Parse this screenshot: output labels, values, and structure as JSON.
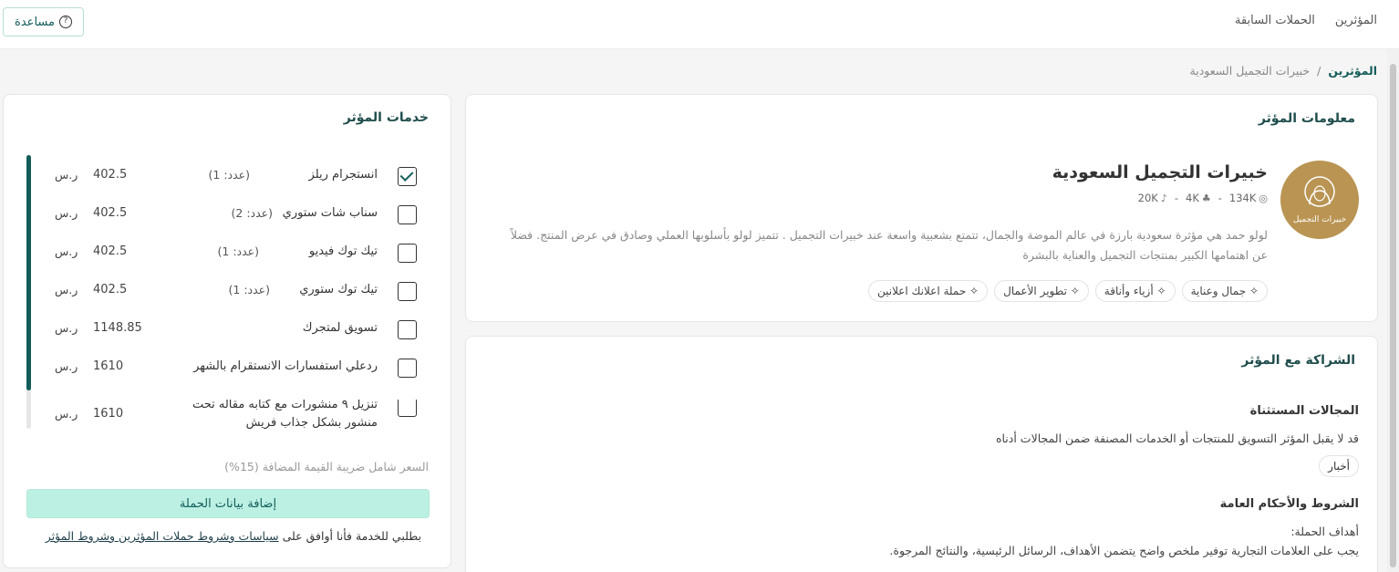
{
  "nav": {
    "influencers": "المؤثرين",
    "past_campaigns": "الحملات السابقة",
    "help": "مساعدة"
  },
  "breadcrumb": {
    "home": "المؤثرين",
    "sep": "/",
    "current": "خبيرات التجميل السعودية"
  },
  "info": {
    "title": "معلومات المؤثر",
    "name": "خبيرات التجميل السعودية",
    "avatar_text": "خبيرات التجميل",
    "stats": [
      {
        "icon": "instagram-icon",
        "glyph": "◎",
        "value": "134K"
      },
      {
        "icon": "snapchat-icon",
        "glyph": "♣",
        "value": "4K"
      },
      {
        "icon": "tiktok-icon",
        "glyph": "♪",
        "value": "20K"
      }
    ],
    "stat_sep": "-",
    "bio": "لولو حمد هي مؤثرة سعودية بارزة في عالم الموضة والجمال، تتمتع بشعبية واسعة عند خبيرات التجميل . تتميز لولو بأسلوبها العملي وصادق في عرض المنتج. فضلاً عن اهتمامها الكبير بمنتجات التجميل والعناية بالبشرة",
    "tags": [
      "جمال وعناية",
      "أزياء وأناقة",
      "تطوير الأعمال",
      "حملة اعلانك اعلانين"
    ]
  },
  "partnership": {
    "title": "الشراكة مع المؤثر",
    "excluded_label": "المجالات المستثناة",
    "excluded_text": "قد لا يقبل المؤثر التسويق للمنتجات أو الخدمات المصنفة ضمن المجالات أدناه",
    "excluded_chip": "أخبار",
    "terms_label": "الشروط والأحكام العامة",
    "goals_label": "أهداف الحملة:",
    "goals_text": "يجب على العلامات التجارية توفير ملخص واضح يتضمن الأهداف، الرسائل الرئيسية، والنتائج المرجوة."
  },
  "services": {
    "title": "خدمات المؤثر",
    "currency": "ر.س",
    "scroll_progress": 0.86,
    "items": [
      {
        "name": "انستجرام ريلز",
        "count": "(عدد: 1)",
        "price": "402.5",
        "checked": true
      },
      {
        "name": "سناب شات ستوري",
        "count": "(عدد: 2)",
        "price": "402.5",
        "checked": false
      },
      {
        "name": "تيك توك فيديو",
        "count": "(عدد: 1)",
        "price": "402.5",
        "checked": false
      },
      {
        "name": "تيك توك ستوري",
        "count": "(عدد: 1)",
        "price": "402.5",
        "checked": false
      },
      {
        "name": "تسويق لمتجرك",
        "count": "",
        "price": "1148.85",
        "checked": false
      },
      {
        "name": "ردعلي استفسارات الانستقرام بالشهر",
        "count": "",
        "price": "1610",
        "checked": false
      },
      {
        "name": "تنزيل ٩ منشورات مع كتابه مقاله تحت منشور بشكل جذاب فريش",
        "count": "",
        "price": "1610",
        "checked": false
      }
    ],
    "vat_note": "السعر شامل ضريبة القيمة المضافة (15%)",
    "add_button": "إضافة بيانات الحملة",
    "terms_prefix": "بطلبي للخدمة فأنا أوافق على",
    "terms_link": "سياسات وشروط حملات المؤثرين وشروط المؤثر"
  }
}
